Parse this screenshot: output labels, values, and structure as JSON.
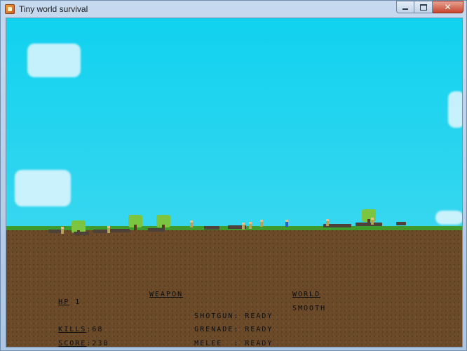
{
  "window": {
    "title": "Tiny world survival",
    "buttons": {
      "close_label": "✕"
    }
  },
  "hud": {
    "hp_label": "HP",
    "hp_value": "1",
    "kills_label": "KILLS",
    "kills_value": "68",
    "score_label": "SCORE",
    "score_value": "238",
    "weapon_heading": "WEAPON",
    "weapons": [
      {
        "name": "SHOTGUN",
        "status": "READY"
      },
      {
        "name": "GRENADE",
        "status": "READY"
      },
      {
        "name": "MELEE  ",
        "status": "READY"
      }
    ],
    "world_heading": "WORLD",
    "world_value": "SMOOTH"
  },
  "colors": {
    "sky": "#10d2ef",
    "grass": "#3f9b2b",
    "dirt": "#6b4a29",
    "tree": "#7cc540"
  }
}
